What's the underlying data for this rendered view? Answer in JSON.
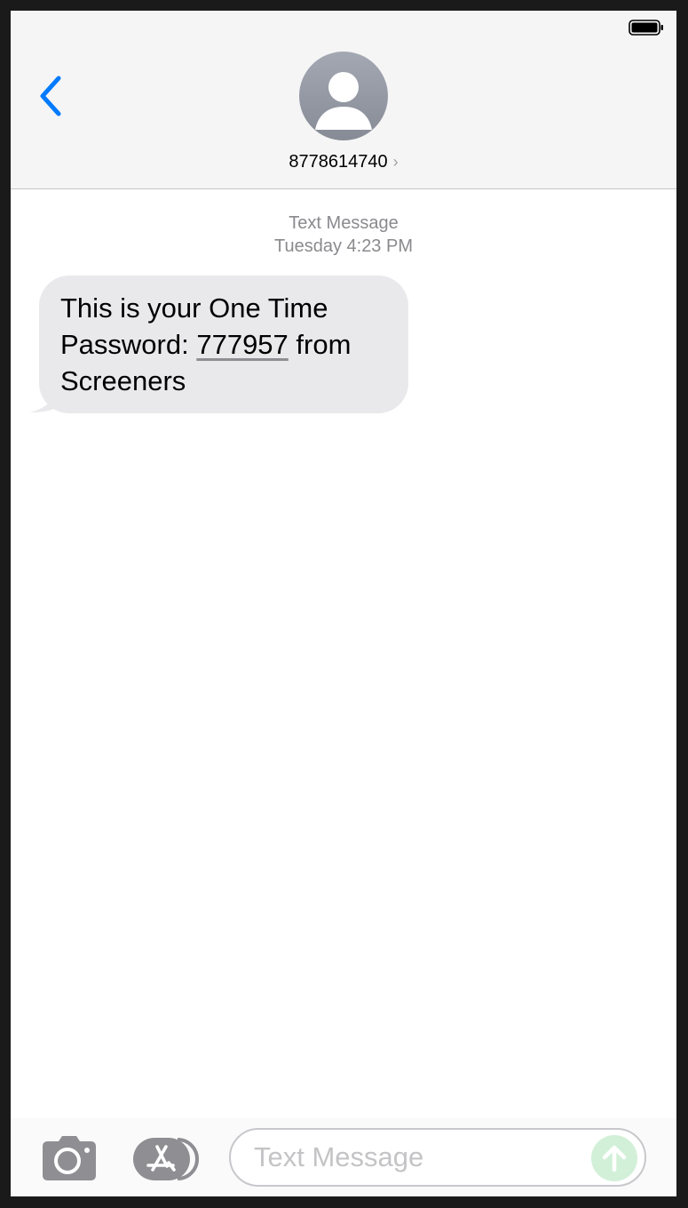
{
  "header": {
    "contact_name": "8778614740",
    "chevron": "›"
  },
  "thread": {
    "service_label": "Text Message",
    "timestamp": "Tuesday 4:23 PM",
    "messages": [
      {
        "direction": "incoming",
        "text_before": "This is your One Time Password: ",
        "otp": "777957",
        "text_after": " from Screeners"
      }
    ]
  },
  "composer": {
    "placeholder": "Text Message"
  },
  "icons": {
    "back": "chevron-left-icon",
    "avatar": "person-icon",
    "battery": "battery-icon",
    "camera": "camera-icon",
    "appstore": "app-store-icon",
    "send": "arrow-up-icon"
  },
  "colors": {
    "accent": "#007aff",
    "incoming_bubble": "#e9e9eb",
    "send_disabled": "#d2f0d8",
    "meta_text": "#8a8a8e"
  }
}
